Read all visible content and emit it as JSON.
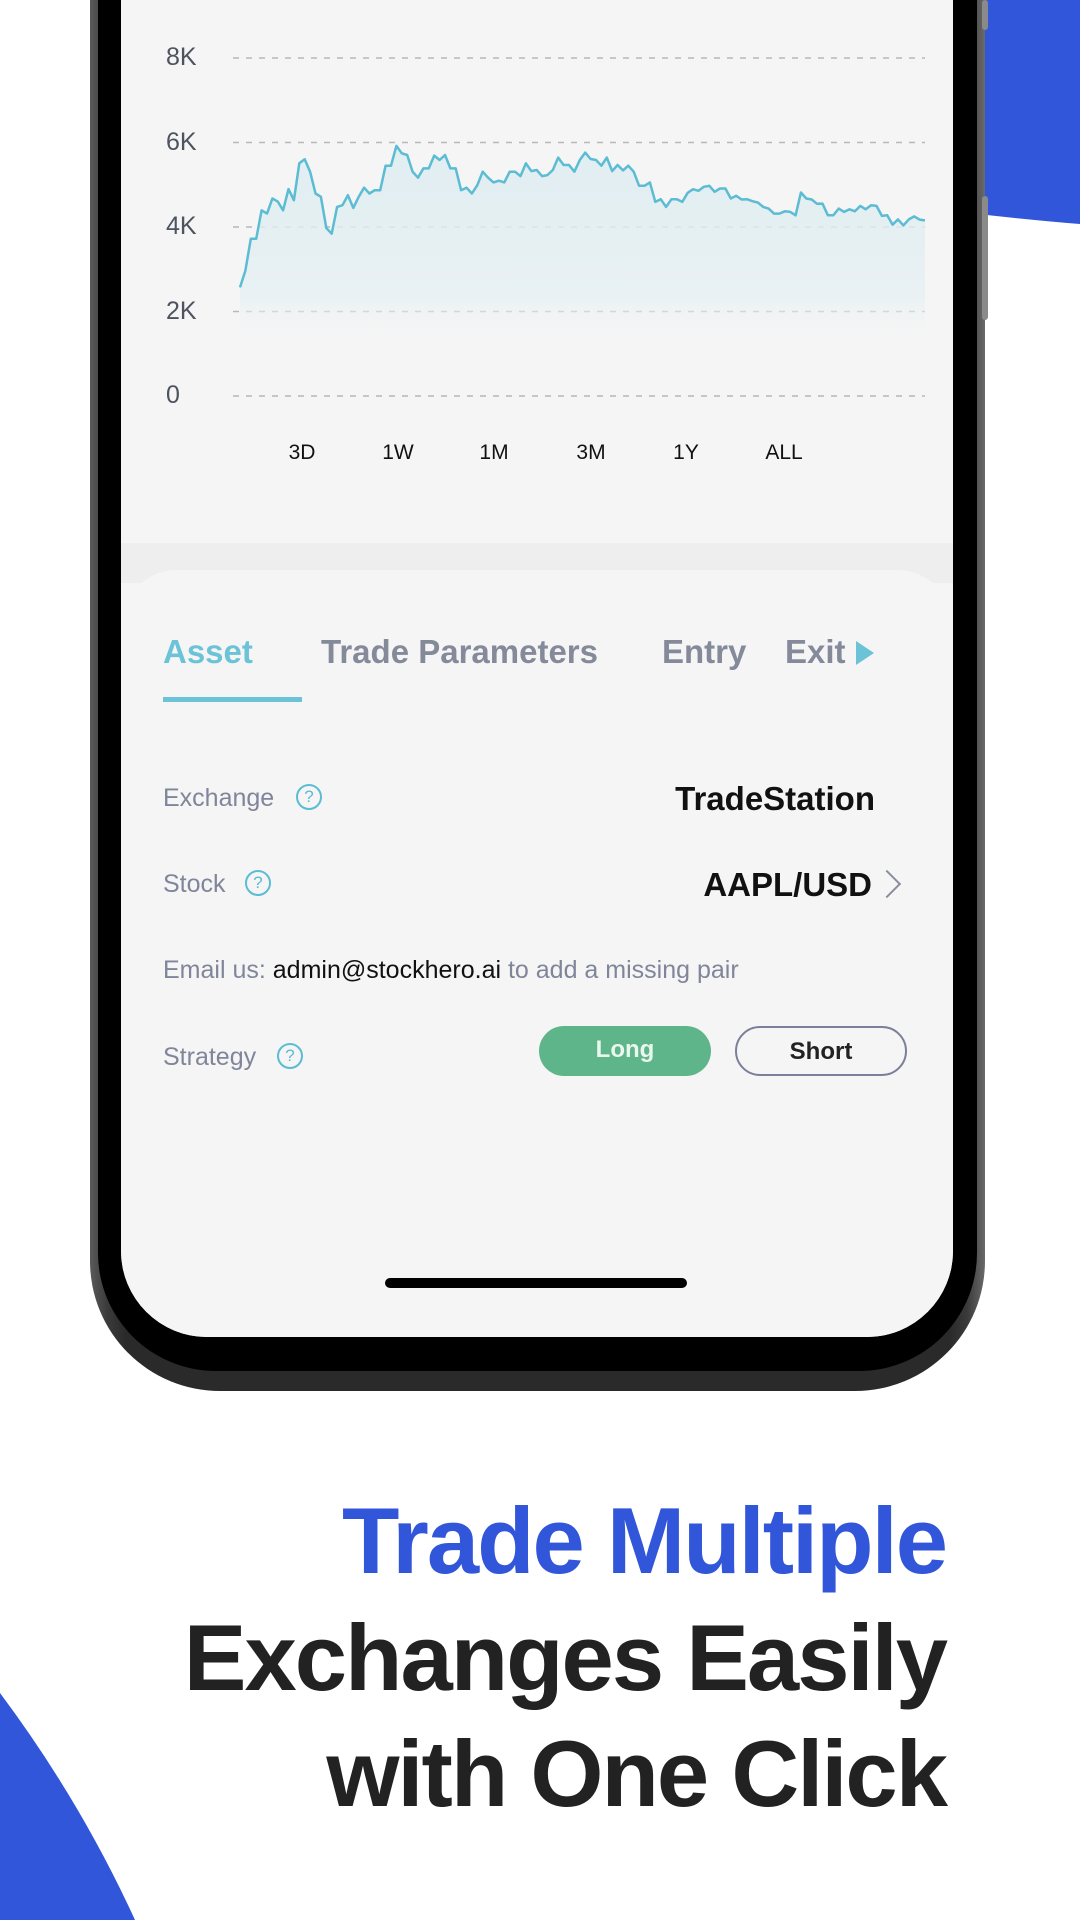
{
  "colors": {
    "brand_blue": "#3156d9",
    "accent_teal": "#6cc2d6",
    "long_green": "#5fb58a",
    "text_dark": "#222222",
    "text_muted": "#80859a",
    "screen_bg": "#f5f5f5"
  },
  "chart_data": {
    "type": "area",
    "title": "",
    "xlabel": "",
    "ylabel": "",
    "ylim": [
      0,
      8000
    ],
    "yticks": [
      0,
      2000,
      4000,
      6000,
      8000
    ],
    "ytick_labels": [
      "0",
      "2K",
      "4K",
      "6K",
      "8K"
    ],
    "grid": true,
    "line_color": "#5bbcd3",
    "series": [
      {
        "name": "portfolio",
        "values": [
          2571,
          2967,
          3721,
          3720,
          4396,
          4317,
          4674,
          4600,
          4396,
          4896,
          4634,
          5507,
          5603,
          5309,
          4793,
          4714,
          3976,
          3841,
          4476,
          4515,
          4753,
          4452,
          4714,
          4929,
          4793,
          4872,
          4872,
          5452,
          5452,
          5919,
          5745,
          5705,
          5309,
          5166,
          5388,
          5388,
          5690,
          5586,
          5705,
          5388,
          5388,
          4872,
          4929,
          4793,
          4990,
          5309,
          5166,
          5055,
          5095,
          5055,
          5309,
          5309,
          5205,
          5507,
          5324,
          5348,
          5205,
          5229,
          5348,
          5643,
          5467,
          5467,
          5309,
          5586,
          5762,
          5610,
          5586,
          5452,
          5643,
          5324,
          5467,
          5340,
          5452,
          5309,
          4976,
          4976,
          5055,
          4595,
          4657,
          4476,
          4657,
          4657,
          4595,
          4810,
          4895,
          4857,
          4952,
          4976,
          4833,
          4912,
          4912,
          4674,
          4738,
          4650,
          4657,
          4610,
          4579,
          4476,
          4436,
          4317,
          4317,
          4371,
          4357,
          4276,
          4817,
          4674,
          4650,
          4548,
          4555,
          4276,
          4276,
          4436,
          4357,
          4419,
          4371,
          4500,
          4419,
          4515,
          4500,
          4262,
          4276,
          4055,
          4181,
          4038,
          4181,
          4252,
          4174,
          4157
        ]
      }
    ],
    "period_options": [
      "3D",
      "1W",
      "1M",
      "3M",
      "1Y",
      "ALL"
    ]
  },
  "tabs": {
    "items": [
      {
        "label": "Asset",
        "active": true
      },
      {
        "label": "Trade Parameters",
        "active": false
      },
      {
        "label": "Entry",
        "active": false
      },
      {
        "label": "Exit",
        "active": false
      }
    ],
    "more_icon": "triangle-right-icon"
  },
  "form": {
    "exchange": {
      "label": "Exchange",
      "value": "TradeStation",
      "help_icon": "question-circle-icon",
      "help_glyph": "?"
    },
    "stock": {
      "label": "Stock",
      "value": "AAPL/USD",
      "help_icon": "question-circle-icon",
      "help_glyph": "?",
      "chevron_icon": "chevron-right-icon"
    },
    "email_note": {
      "prefix": "Email us: ",
      "email": "admin@stockhero.ai",
      "suffix": " to add a missing pair"
    },
    "strategy": {
      "label": "Strategy",
      "help_glyph": "?",
      "options": [
        {
          "label": "Long",
          "selected": true
        },
        {
          "label": "Short",
          "selected": false
        }
      ]
    }
  },
  "headline": {
    "line1": "Trade Multiple",
    "line2": "Exchanges Easily",
    "line3": "with One Click"
  }
}
